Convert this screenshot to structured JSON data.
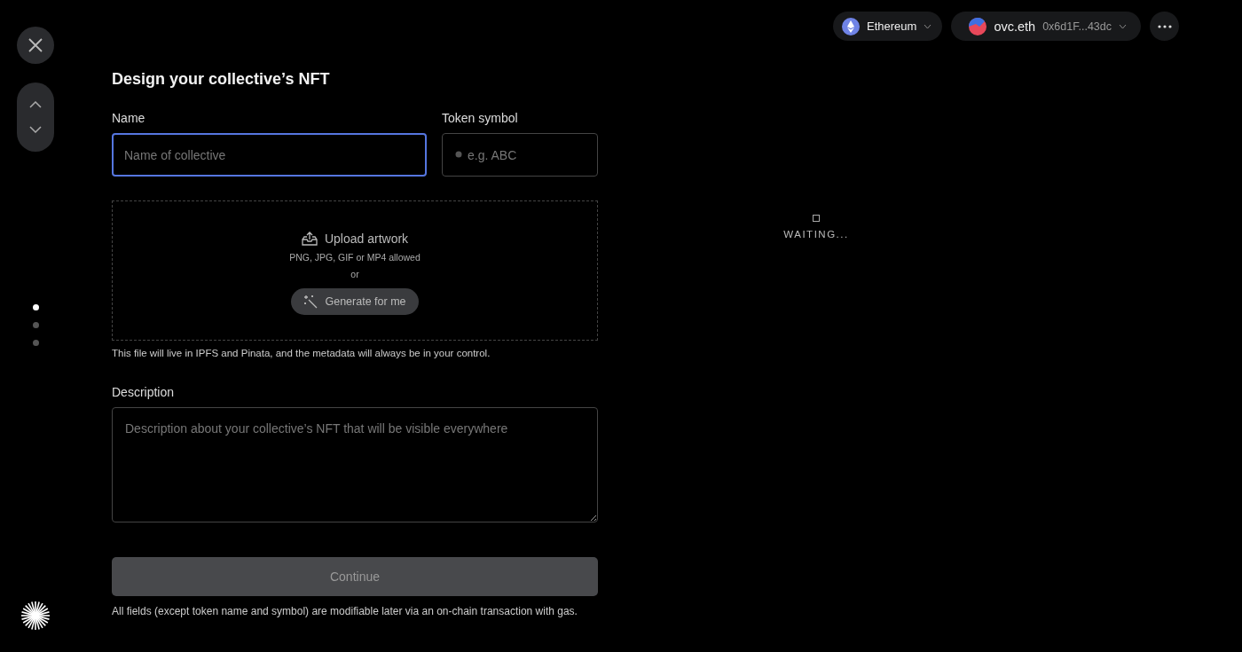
{
  "steps": [
    {
      "selected": true
    },
    {
      "selected": false
    },
    {
      "selected": false
    }
  ],
  "title": "Design your collective’s NFT",
  "name_field": {
    "label": "Name",
    "placeholder": "Name of collective",
    "focused": true
  },
  "token_field": {
    "label": "Token symbol",
    "placeholder": "e.g. ABC",
    "focused": false
  },
  "upload": {
    "title": "Upload artwork",
    "formats": "PNG, JPG, GIF or MP4 allowed",
    "separator": "or",
    "generate": "Generate for me"
  },
  "upload_note": "This file will live in IPFS and Pinata, and the metadata will always be in your control.",
  "description": {
    "label": "Description",
    "placeholder": "Description about your collective’s NFT that will be visible everywhere"
  },
  "continue": {
    "label": "Continue",
    "disabled": true
  },
  "footnote": "All fields (except token name and symbol) are modifiable later via an on-chain transaction with gas.",
  "network": {
    "label": "Ethereum"
  },
  "account": {
    "name": "ovc.eth",
    "address": "0x6d1F...43dc"
  },
  "status": {
    "label": "WAITING..."
  }
}
